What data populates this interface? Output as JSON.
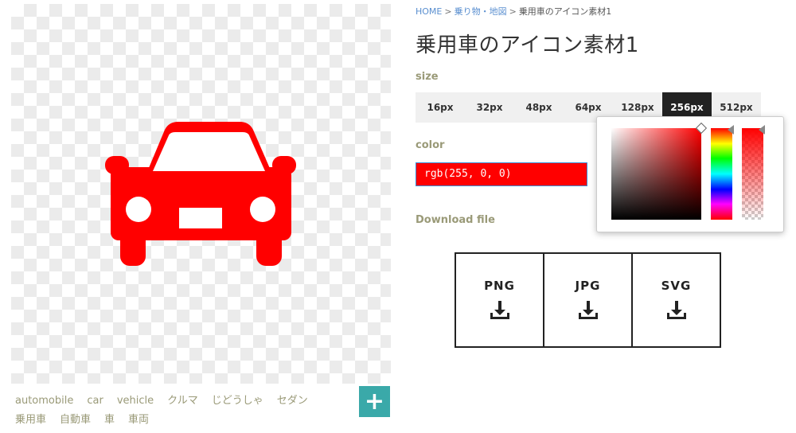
{
  "breadcrumb": {
    "home": "HOME",
    "category": "乗り物・地図",
    "current": "乗用車のアイコン素材1",
    "sep": ">"
  },
  "title": "乗用車のアイコン素材1",
  "size": {
    "label": "size",
    "options": [
      "16px",
      "32px",
      "48px",
      "64px",
      "128px",
      "256px",
      "512px"
    ],
    "selected": "256px"
  },
  "color": {
    "label": "color",
    "value": "rgb(255, 0, 0)",
    "hex": "#ff0000"
  },
  "download": {
    "label": "Download file",
    "formats": [
      "PNG",
      "JPG",
      "SVG"
    ]
  },
  "tags": [
    "automobile",
    "car",
    "vehicle",
    "クルマ",
    "じどうしゃ",
    "セダン",
    "乗用車",
    "自動車",
    "車",
    "車両"
  ],
  "add_button": {
    "label": "+"
  },
  "icons": {
    "preview": "car-icon",
    "download": "download-icon",
    "add": "plus-icon"
  },
  "colors": {
    "accent": "#3aa9a9",
    "active_tab": "#222222",
    "icon": "#ff0000",
    "tag_text": "#9a9a78"
  }
}
